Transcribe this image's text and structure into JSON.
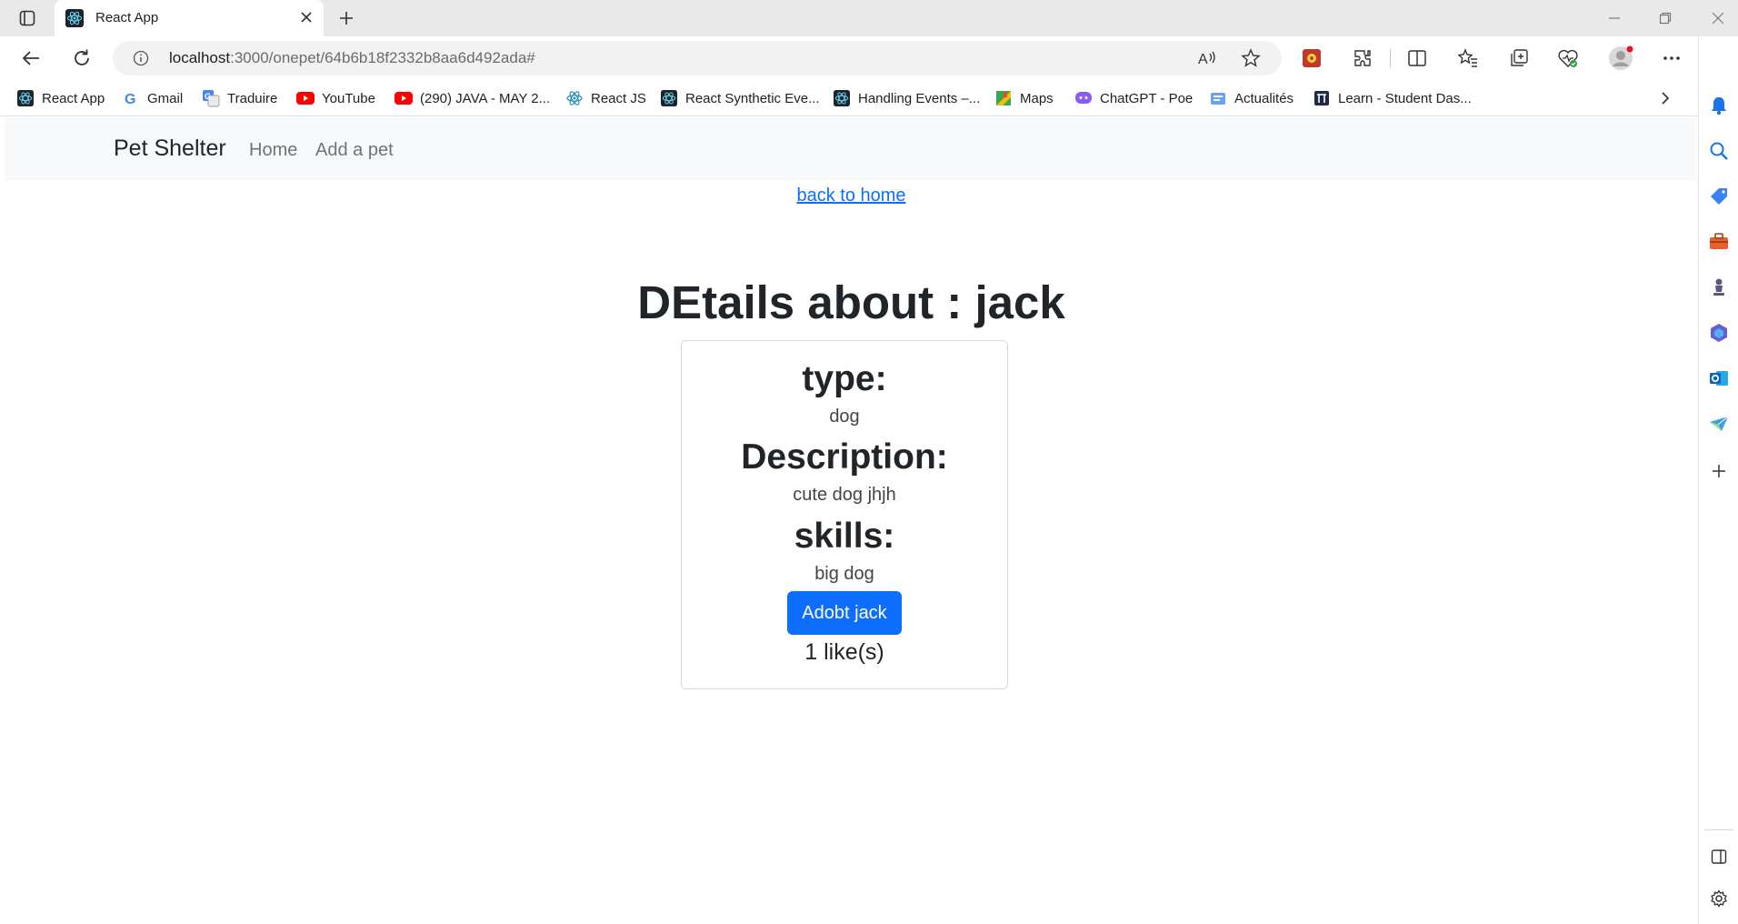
{
  "browser": {
    "tab_title": "React App",
    "url_host": "localhost",
    "url_path": ":3000/onepet/64b6b18f2332b8aa6d492ada#"
  },
  "bookmarks": [
    {
      "label": "React App",
      "icon": "react-icon"
    },
    {
      "label": "Gmail",
      "icon": "google-icon"
    },
    {
      "label": "Traduire",
      "icon": "translate-icon"
    },
    {
      "label": "YouTube",
      "icon": "youtube-icon"
    },
    {
      "label": "(290) JAVA - MAY 2...",
      "icon": "youtube-icon"
    },
    {
      "label": "React JS",
      "icon": "react-icon"
    },
    {
      "label": "React Synthetic Eve...",
      "icon": "react-icon"
    },
    {
      "label": "Handling Events –...",
      "icon": "react-icon"
    },
    {
      "label": "Maps",
      "icon": "maps-icon"
    },
    {
      "label": "ChatGPT - Poe",
      "icon": "poe-icon"
    },
    {
      "label": "Actualités",
      "icon": "news-icon"
    },
    {
      "label": "Learn - Student Das...",
      "icon": "learn-icon"
    }
  ],
  "navbar": {
    "brand": "Pet Shelter",
    "links": [
      "Home",
      "Add a pet"
    ]
  },
  "page": {
    "back_link": "back to home",
    "heading": "DEtails about : jack",
    "type_label": "type:",
    "type_value": "dog",
    "description_label": "Description:",
    "description_value": "cute dog jhjh",
    "skills_label": "skills:",
    "skills_value": "big dog",
    "adopt_button": "Adobt jack",
    "likes": "1 like(s)"
  },
  "colors": {
    "primary": "#0d6efd",
    "navbar_bg": "#f8f9fa",
    "text": "#212529"
  }
}
